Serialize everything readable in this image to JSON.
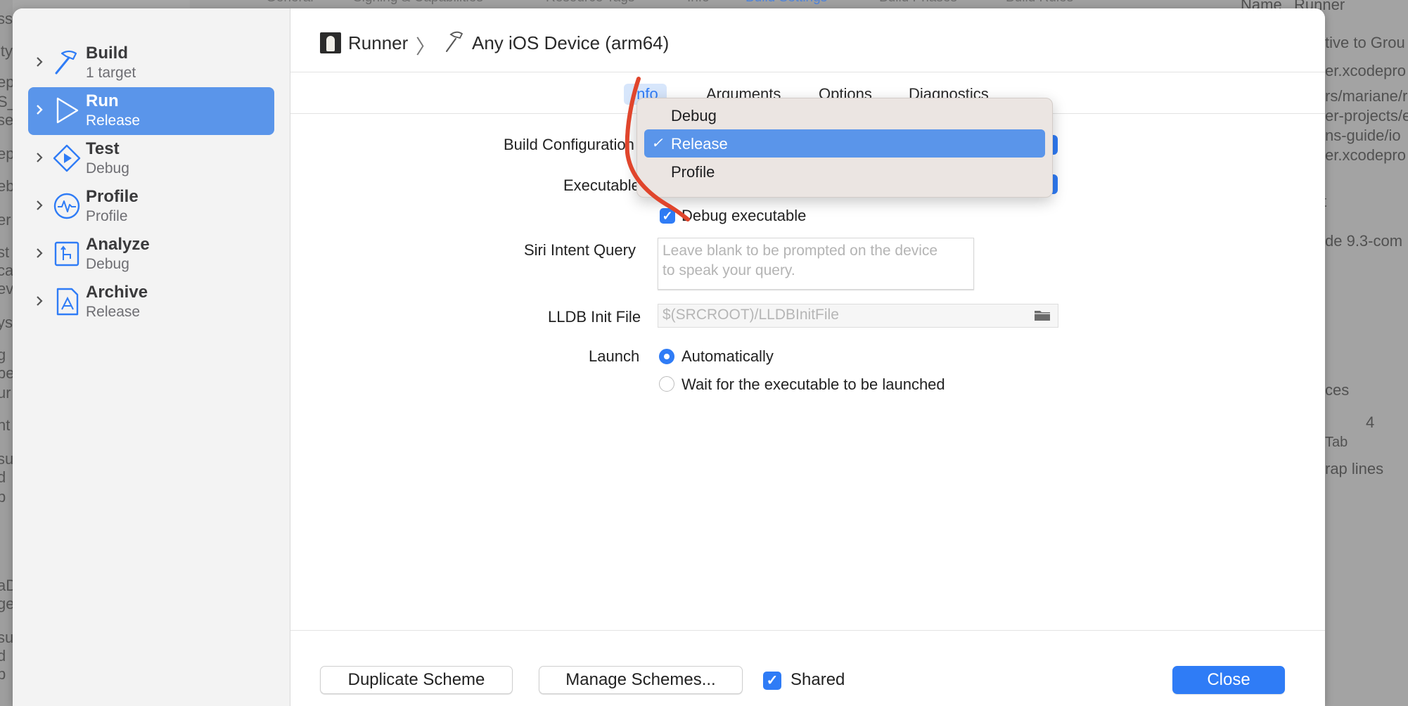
{
  "background": {
    "tabs": [
      "General",
      "Signing & Capabilities",
      "Resource Tags",
      "Info",
      "Build Settings",
      "Build Phases",
      "Build Rules"
    ],
    "inspector_name_label": "Name",
    "inspector_name_value": "Runner",
    "right_fragments": [
      "tive to Grou",
      "er.xcodepro",
      "rs/mariane/r",
      "er-projects/e",
      "ns-guide/io",
      "er.xcodepro",
      "t",
      "de 9.3-com",
      "ces",
      "4",
      "Tab",
      "rap lines"
    ]
  },
  "sidebar": {
    "items": [
      {
        "title": "Build",
        "subtitle": "1 target",
        "icon": "hammer-icon"
      },
      {
        "title": "Run",
        "subtitle": "Release",
        "icon": "play-icon",
        "selected": true
      },
      {
        "title": "Test",
        "subtitle": "Debug",
        "icon": "test-diamond-icon"
      },
      {
        "title": "Profile",
        "subtitle": "Profile",
        "icon": "waveform-icon"
      },
      {
        "title": "Analyze",
        "subtitle": "Debug",
        "icon": "analyze-branch-icon"
      },
      {
        "title": "Archive",
        "subtitle": "Release",
        "icon": "archive-app-icon"
      }
    ]
  },
  "header": {
    "scheme": "Runner",
    "destination": "Any iOS Device (arm64)",
    "separator": "〉"
  },
  "tabs": [
    {
      "label": "Info",
      "active": true
    },
    {
      "label": "Arguments"
    },
    {
      "label": "Options"
    },
    {
      "label": "Diagnostics"
    }
  ],
  "form": {
    "build_configuration_label": "Build Configuration",
    "executable_label": "Executable",
    "debug_executable_label": "Debug executable",
    "debug_executable_checked": true,
    "siri_label": "Siri Intent Query",
    "siri_placeholder": "Leave blank to be prompted on the device to speak your query.",
    "lldb_label": "LLDB Init File",
    "lldb_placeholder": "$(SRCROOT)/LLDBInitFile",
    "launch_label": "Launch",
    "launch_options": [
      "Automatically",
      "Wait for the executable to be launched"
    ],
    "launch_selected": "Automatically"
  },
  "dropdown": {
    "options": [
      "Debug",
      "Release",
      "Profile"
    ],
    "selected": "Release",
    "check": "✓"
  },
  "footer": {
    "duplicate_label": "Duplicate Scheme",
    "manage_label": "Manage Schemes...",
    "shared_label": "Shared",
    "shared_checked": true,
    "close_label": "Close"
  },
  "colors": {
    "accent": "#2f7cf6",
    "selection": "#5a95ea",
    "annotation": "#e0452c"
  }
}
